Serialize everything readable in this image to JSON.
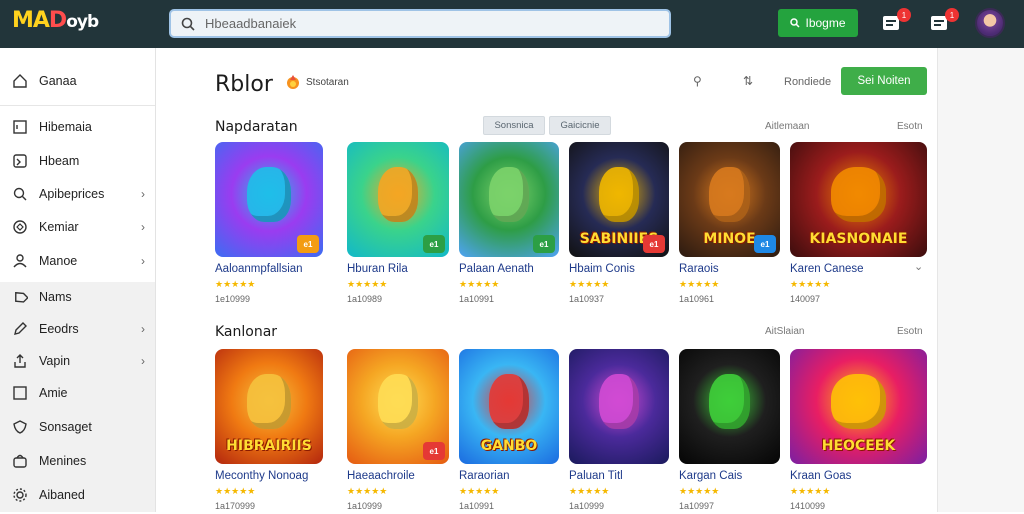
{
  "app": {
    "logo_part1": "MA",
    "logo_part2": "D",
    "logo_part3": "oyb"
  },
  "search": {
    "placeholder": "Hbeaadbanaiek"
  },
  "topbar": {
    "login_label": "Ibogme",
    "badge1": "1",
    "badge2": "1"
  },
  "sidebar": {
    "items": [
      {
        "label": "Ganaa",
        "icon": "home-icon",
        "chevron": false
      },
      {
        "label": "Hibemaia",
        "icon": "square-icon",
        "chevron": false
      },
      {
        "label": "Hbeam",
        "icon": "tv-icon",
        "chevron": false
      },
      {
        "label": "Apibeprices",
        "icon": "search-icon",
        "chevron": true
      },
      {
        "label": "Kemiar",
        "icon": "compass-icon",
        "chevron": true
      },
      {
        "label": "Manoe",
        "icon": "person-icon",
        "chevron": true
      },
      {
        "label": "Nams",
        "icon": "tag-icon",
        "chevron": false
      },
      {
        "label": "Eeodrs",
        "icon": "edit-icon",
        "chevron": true
      },
      {
        "label": "Vapin",
        "icon": "share-icon",
        "chevron": true
      },
      {
        "label": "Amie",
        "icon": "box-icon",
        "chevron": false
      },
      {
        "label": "Sonsaget",
        "icon": "shield-icon",
        "chevron": false
      },
      {
        "label": "Menines",
        "icon": "bag-icon",
        "chevron": false
      },
      {
        "label": "Aibaned",
        "icon": "gear-icon",
        "chevron": false
      }
    ]
  },
  "header": {
    "title": "Rblor",
    "subbrand": "Stsotaran",
    "link_text": "Rondiede",
    "cta_label": "Sei Noiten"
  },
  "sections": [
    {
      "title": "Napdaratan",
      "chips": [
        "Sonsnica",
        "Gaicicnie"
      ],
      "link": "Aitlemaan",
      "more": "Esotn",
      "cards": [
        {
          "title": "Aaloanmpfallsian",
          "stars": "★★★★★",
          "count": "1e10999",
          "art_text": "",
          "mini": "e1",
          "colors": [
            "#3b6df2",
            "#9a3cf0",
            "#1fbfe9"
          ],
          "mini_color": "#f39c12"
        },
        {
          "title": "Hburan Rila",
          "stars": "★★★★★",
          "count": "1a10989",
          "art_text": "",
          "mini": "e1",
          "colors": [
            "#12b8c9",
            "#3ad38b",
            "#f5a623"
          ],
          "mini_color": "#2c9f45"
        },
        {
          "title": "Palaan Aenath",
          "stars": "★★★★★",
          "count": "1a10991",
          "art_text": "",
          "mini": "e1",
          "colors": [
            "#4fa3f5",
            "#2e9d46",
            "#7cd36b"
          ],
          "mini_color": "#2c9f45"
        },
        {
          "title": "Hbaim Conis",
          "stars": "★★★★★",
          "count": "1a10937",
          "art_text": "SABINIIES",
          "mini": "e1",
          "colors": [
            "#111111",
            "#262b55",
            "#f0b700"
          ],
          "mini_color": "#e53935"
        },
        {
          "title": "Raraois",
          "stars": "★★★★★",
          "count": "1a10961",
          "art_text": "MINOE",
          "mini": "e1",
          "colors": [
            "#2b1a10",
            "#6b3a17",
            "#d87a1e"
          ],
          "mini_color": "#1e88e5"
        },
        {
          "title": "Karen Canese",
          "stars": "★★★★★",
          "count": "140097",
          "art_text": "KIASNONAIE",
          "mini": "",
          "colors": [
            "#3b0d0d",
            "#9b1c1c",
            "#f28a00"
          ],
          "mini_color": "#e53935"
        }
      ]
    },
    {
      "title": "Kanlonar",
      "chips": [],
      "link": "AitSlaian",
      "more": "Esotn",
      "cards": [
        {
          "title": "Meconthy Nonoag",
          "stars": "★★★★★",
          "count": "1a170999",
          "art_text": "HIBRAIRIIS",
          "mini": "",
          "colors": [
            "#b3260e",
            "#f07a12",
            "#f6c23e"
          ],
          "mini_color": "#e53935"
        },
        {
          "title": "Haeaachroile",
          "stars": "★★★★★",
          "count": "1a10999",
          "art_text": "",
          "mini": "e1",
          "colors": [
            "#e55a12",
            "#f5a623",
            "#ffdd55"
          ],
          "mini_color": "#e53935"
        },
        {
          "title": "Raraorian",
          "stars": "★★★★★",
          "count": "1a10991",
          "art_text": "GANBO",
          "mini": "",
          "colors": [
            "#1b6be0",
            "#39b6f4",
            "#e53935"
          ],
          "mini_color": "#e53935"
        },
        {
          "title": "Paluan Titl",
          "stars": "★★★★★",
          "count": "1a10999",
          "art_text": "",
          "mini": "",
          "colors": [
            "#1a1a5c",
            "#4b2a9b",
            "#d24bd4"
          ],
          "mini_color": "#e53935"
        },
        {
          "title": "Kargan Cais",
          "stars": "★★★★★",
          "count": "1a10997",
          "art_text": "",
          "mini": "",
          "colors": [
            "#050505",
            "#1f1f1f",
            "#3fcf3a"
          ],
          "mini_color": "#2c9f45"
        },
        {
          "title": "Kraan Goas",
          "stars": "★★★★★",
          "count": "1410099",
          "art_text": "HEOCEEK",
          "mini": "",
          "colors": [
            "#7b1fa2",
            "#e91e63",
            "#ffc107"
          ],
          "mini_color": "#e53935"
        }
      ]
    }
  ]
}
